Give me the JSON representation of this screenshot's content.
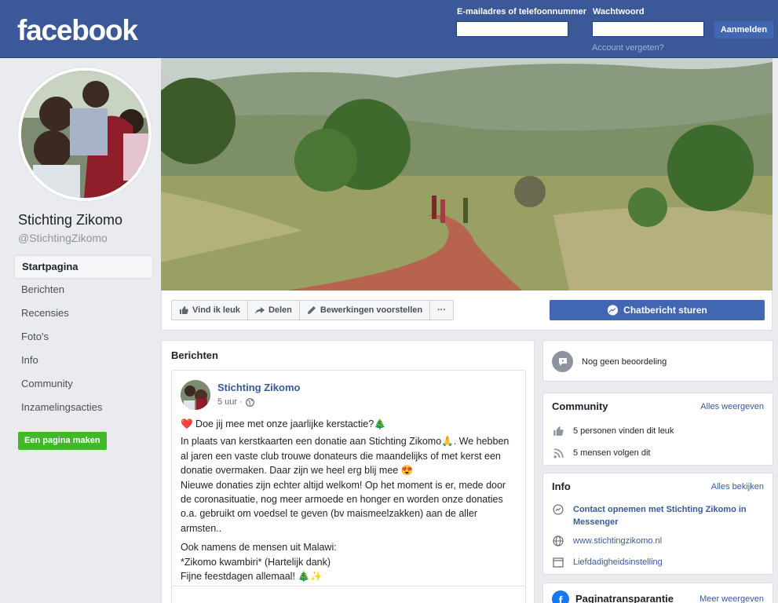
{
  "header": {
    "logo": "facebook",
    "email_label": "E-mailadres of telefoonnummer",
    "password_label": "Wachtwoord",
    "email_value": "",
    "password_value": "",
    "login_button": "Aanmelden",
    "forgot_link": "Account vergeten?",
    "brand_color": "#3b5998"
  },
  "page": {
    "name": "Stichting Zikomo",
    "handle": "@StichtingZikomo"
  },
  "sidebar": {
    "items": [
      {
        "label": "Startpagina",
        "active": true
      },
      {
        "label": "Berichten"
      },
      {
        "label": "Recensies"
      },
      {
        "label": "Foto's"
      },
      {
        "label": "Info"
      },
      {
        "label": "Community"
      },
      {
        "label": "Inzamelingsacties"
      }
    ],
    "make_page": "Een pagina maken"
  },
  "actions": {
    "like": "Vind ik leuk",
    "share": "Delen",
    "suggest": "Bewerkingen voorstellen",
    "more": "···",
    "message": "Chatbericht sturen"
  },
  "posts": {
    "title": "Berichten",
    "post": {
      "author": "Stichting Zikomo",
      "time": "5 uur ·",
      "paragraphs": [
        "❤️ Doe jij mee met onze jaarlijke kerstactie?🎄",
        "In plaats van kerstkaarten een donatie aan Stichting Zikomo🙏. We hebben al jaren een vaste club trouwe donateurs die maandelijks of met kerst een donatie overmaken. Daar zijn we heel erg blij mee 😍",
        "Nieuwe donaties zijn echter altijd welkom! Op het moment is er, mede door de coronasituatie, nog meer armoede en honger en worden onze donaties o.a. gebruikt om voedsel te geven (bv maismeelzakken) aan de aller armsten..",
        "Ook namens de mensen uit Malawi:",
        "*Zikomo kwambiri* (Hartelijk dank)",
        "Fijne feestdagen allemaal! 🎄✨"
      ]
    }
  },
  "right": {
    "rating": "Nog geen beoordeling",
    "community": {
      "title": "Community",
      "link": "Alles weergeven",
      "likes": "5 personen vinden dit leuk",
      "follows": "5 mensen volgen dit"
    },
    "info": {
      "title": "Info",
      "link": "Alles bekijken",
      "contact": "Contact opnemen met Stichting Zikomo in Messenger",
      "website": "www.stichtingzikomo.nl",
      "category": "Liefdadigheidsinstelling"
    },
    "transparency": {
      "title": "Paginatransparantie",
      "link": "Meer weergeven"
    }
  }
}
